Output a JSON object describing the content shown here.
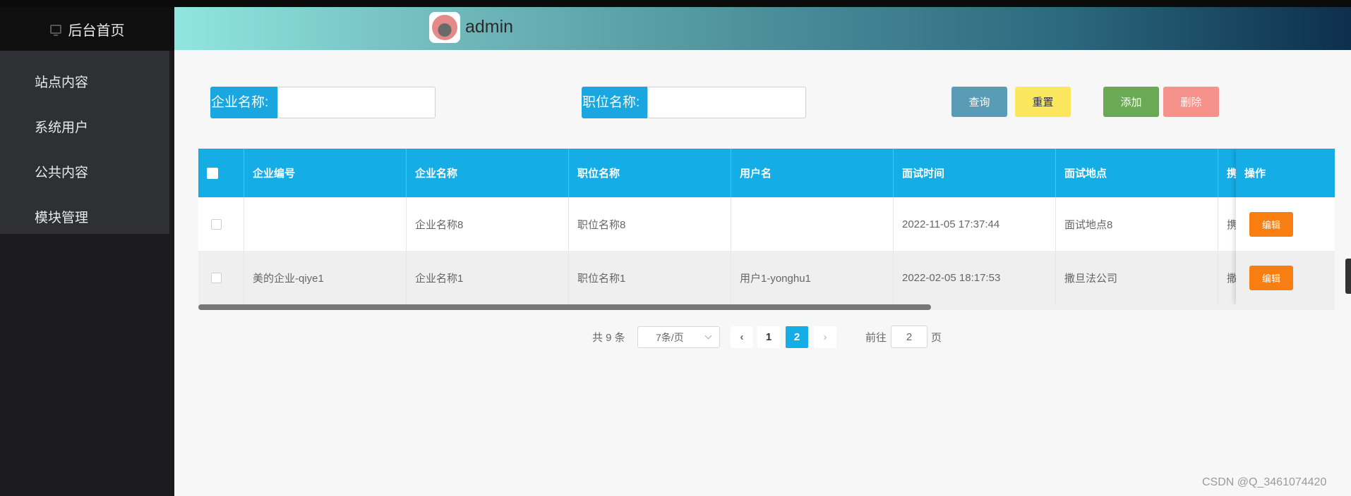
{
  "sidebar": {
    "home_label": "后台首页",
    "items": [
      {
        "label": "站点内容"
      },
      {
        "label": "系统用户"
      },
      {
        "label": "公共内容"
      },
      {
        "label": "模块管理"
      }
    ]
  },
  "header": {
    "username": "admin"
  },
  "search": {
    "company_label": "企业名称:",
    "company_value": "",
    "position_label": "职位名称:",
    "position_value": "",
    "buttons": {
      "query": "查询",
      "reset": "重置",
      "add": "添加",
      "delete": "删除"
    }
  },
  "table": {
    "columns": [
      "企业编号",
      "企业名称",
      "职位名称",
      "用户名",
      "面试时间",
      "面试地点",
      "携",
      "操作"
    ],
    "rows": [
      {
        "company_no": "",
        "company_name": "企业名称8",
        "position": "职位名称8",
        "username": "",
        "interview_time": "2022-11-05 17:37:44",
        "interview_place": "面试地点8",
        "truncated": "携",
        "action": "编辑"
      },
      {
        "company_no": "美的企业-qiye1",
        "company_name": "企业名称1",
        "position": "职位名称1",
        "username": "用户1-yonghu1",
        "interview_time": "2022-02-05 18:17:53",
        "interview_place": "撒旦法公司",
        "truncated": "撒",
        "action": "编辑"
      }
    ]
  },
  "pagination": {
    "total": "共 9 条",
    "page_size": "7条/页",
    "pages": [
      "1",
      "2"
    ],
    "current_page": "2",
    "goto_label": "前往",
    "goto_value": "2",
    "page_suffix": "页",
    "prev_icon": "chevron-left-icon",
    "next_icon": "chevron-right-icon"
  },
  "colors": {
    "accent": "#14ade6",
    "query": "#5a9bb5",
    "reset": "#fbe75d",
    "add": "#6aaa54",
    "delete": "#f7918b",
    "edit": "#f97e12"
  },
  "watermark": "CSDN @Q_3461074420"
}
